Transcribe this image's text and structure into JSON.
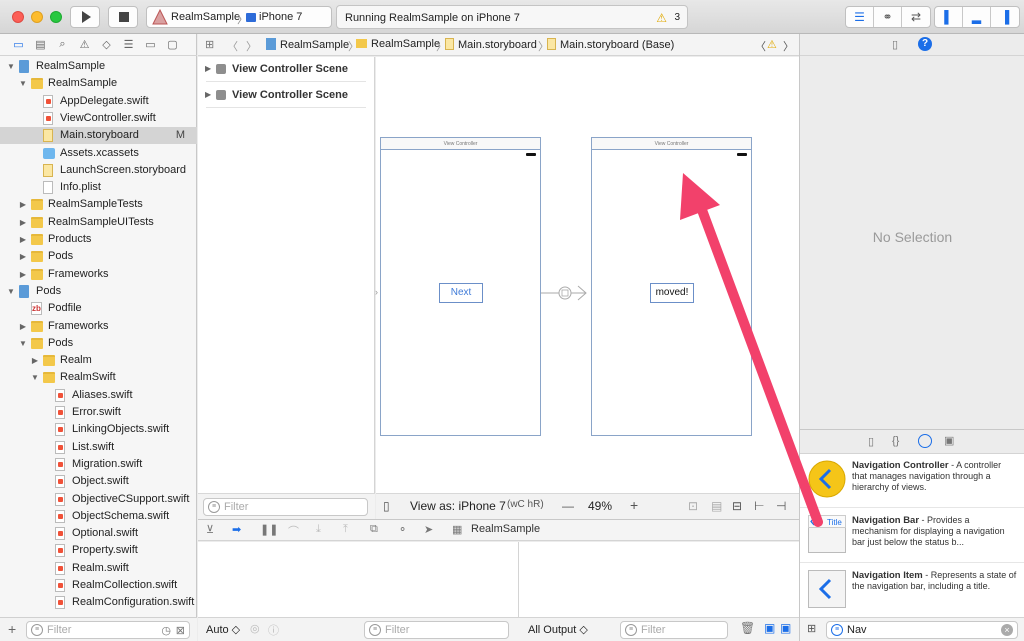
{
  "toolbar": {
    "scheme_name": "RealmSample",
    "device": "iPhone 7",
    "activity_text": "Running RealmSample on iPhone 7",
    "warning_count": "3"
  },
  "navigator": {
    "items": [
      {
        "label": "RealmSample",
        "icon": "project",
        "indent": 0,
        "disclosure": "open"
      },
      {
        "label": "RealmSample",
        "icon": "folder",
        "indent": 1,
        "disclosure": "open"
      },
      {
        "label": "AppDelegate.swift",
        "icon": "swift",
        "indent": 2,
        "disclosure": ""
      },
      {
        "label": "ViewController.swift",
        "icon": "swift",
        "indent": 2,
        "disclosure": ""
      },
      {
        "label": "Main.storyboard",
        "icon": "storyboard",
        "indent": 2,
        "disclosure": "",
        "badge": "M",
        "selected": true
      },
      {
        "label": "Assets.xcassets",
        "icon": "assets",
        "indent": 2,
        "disclosure": ""
      },
      {
        "label": "LaunchScreen.storyboard",
        "icon": "storyboard",
        "indent": 2,
        "disclosure": ""
      },
      {
        "label": "Info.plist",
        "icon": "plist",
        "indent": 2,
        "disclosure": ""
      },
      {
        "label": "RealmSampleTests",
        "icon": "folder",
        "indent": 1,
        "disclosure": "closed"
      },
      {
        "label": "RealmSampleUITests",
        "icon": "folder",
        "indent": 1,
        "disclosure": "closed"
      },
      {
        "label": "Products",
        "icon": "folder",
        "indent": 1,
        "disclosure": "closed"
      },
      {
        "label": "Pods",
        "icon": "folder",
        "indent": 1,
        "disclosure": "closed"
      },
      {
        "label": "Frameworks",
        "icon": "folder",
        "indent": 1,
        "disclosure": "closed"
      },
      {
        "label": "Pods",
        "icon": "project",
        "indent": 0,
        "disclosure": "open"
      },
      {
        "label": "Podfile",
        "icon": "pod",
        "indent": 1,
        "disclosure": ""
      },
      {
        "label": "Frameworks",
        "icon": "folder",
        "indent": 1,
        "disclosure": "closed"
      },
      {
        "label": "Pods",
        "icon": "folder",
        "indent": 1,
        "disclosure": "open"
      },
      {
        "label": "Realm",
        "icon": "folder",
        "indent": 2,
        "disclosure": "closed"
      },
      {
        "label": "RealmSwift",
        "icon": "folder",
        "indent": 2,
        "disclosure": "open"
      },
      {
        "label": "Aliases.swift",
        "icon": "swift",
        "indent": 3,
        "disclosure": ""
      },
      {
        "label": "Error.swift",
        "icon": "swift",
        "indent": 3,
        "disclosure": ""
      },
      {
        "label": "LinkingObjects.swift",
        "icon": "swift",
        "indent": 3,
        "disclosure": ""
      },
      {
        "label": "List.swift",
        "icon": "swift",
        "indent": 3,
        "disclosure": ""
      },
      {
        "label": "Migration.swift",
        "icon": "swift",
        "indent": 3,
        "disclosure": ""
      },
      {
        "label": "Object.swift",
        "icon": "swift",
        "indent": 3,
        "disclosure": ""
      },
      {
        "label": "ObjectiveCSupport.swift",
        "icon": "swift",
        "indent": 3,
        "disclosure": ""
      },
      {
        "label": "ObjectSchema.swift",
        "icon": "swift",
        "indent": 3,
        "disclosure": ""
      },
      {
        "label": "Optional.swift",
        "icon": "swift",
        "indent": 3,
        "disclosure": ""
      },
      {
        "label": "Property.swift",
        "icon": "swift",
        "indent": 3,
        "disclosure": ""
      },
      {
        "label": "Realm.swift",
        "icon": "swift",
        "indent": 3,
        "disclosure": ""
      },
      {
        "label": "RealmCollection.swift",
        "icon": "swift",
        "indent": 3,
        "disclosure": ""
      },
      {
        "label": "RealmConfiguration.swift",
        "icon": "swift",
        "indent": 3,
        "disclosure": ""
      }
    ],
    "filter_placeholder": "Filter"
  },
  "jumpbar": {
    "crumbs": [
      "RealmSample",
      "RealmSample",
      "Main.storyboard",
      "Main.storyboard (Base)"
    ]
  },
  "outline": {
    "scenes": [
      "View Controller Scene",
      "View Controller Scene"
    ],
    "filter_placeholder": "Filter"
  },
  "canvas": {
    "vc1_title": "View Controller",
    "vc2_title": "View Controller",
    "button_next": "Next",
    "button_moved": "moved!",
    "view_as": "View as: iPhone 7",
    "size_class": "(wC hR)",
    "zoom_minus": "—",
    "zoom": "49%",
    "zoom_plus": "+"
  },
  "debug": {
    "target_label": "RealmSample",
    "auto_label": "Auto ◇",
    "all_output_label": "All Output ◇",
    "filter_placeholder": "Filter"
  },
  "inspector": {
    "no_selection": "No Selection"
  },
  "library": {
    "items": [
      {
        "name": "Navigation Controller",
        "description": " - A controller that manages navigation through a hierarchy of views."
      },
      {
        "name": "Navigation Bar",
        "description": " - Provides a mechanism for displaying a navigation bar just below the status b..."
      },
      {
        "name": "Navigation Item",
        "description": " - Represents a state of the navigation bar, including a title."
      }
    ],
    "nav_bar_thumb_text": "Title",
    "search_value": "Nav"
  },
  "colors": {
    "accent": "#1b6ee8",
    "annotation_arrow": "#f2416b",
    "lib_icon_yellow": "#f5c518"
  }
}
